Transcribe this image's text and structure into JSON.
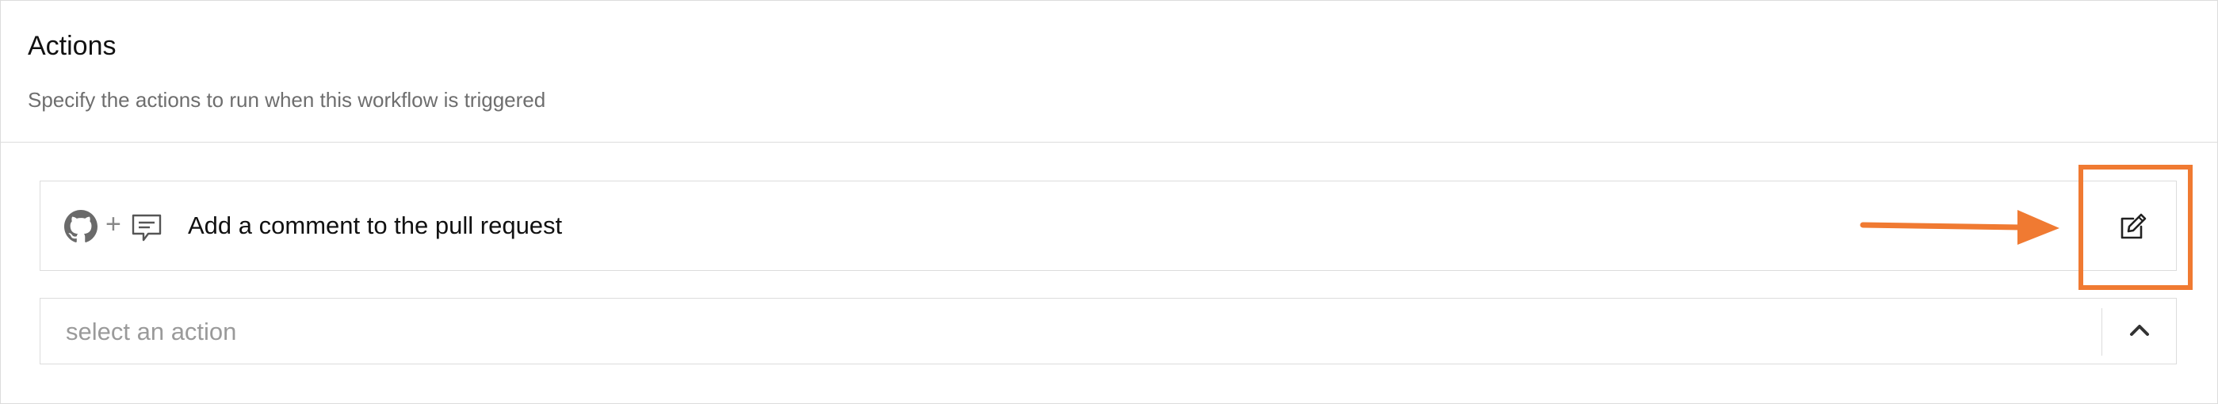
{
  "section": {
    "title": "Actions",
    "subtitle": "Specify the actions to run when this workflow is triggered"
  },
  "action": {
    "separator": "+",
    "label": "Add a comment to the pull request",
    "icons": [
      "github-icon",
      "comment-icon",
      "edit-icon"
    ]
  },
  "select": {
    "placeholder": "select an action",
    "icon": "chevron-up-icon"
  },
  "annotation": {
    "color": "#f07a32"
  }
}
